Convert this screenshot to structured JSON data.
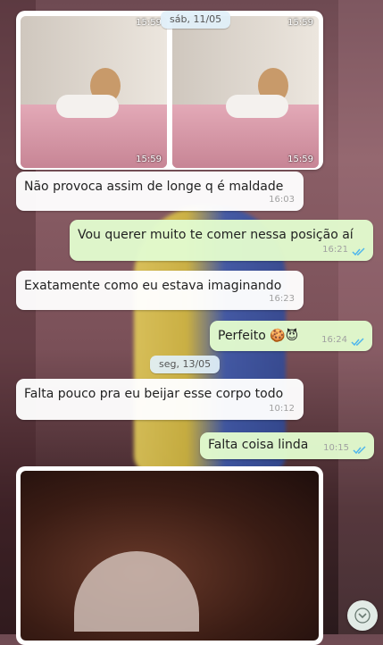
{
  "photos": {
    "left_time": "15:59",
    "right_time": "15:59",
    "header_left_time": "15:59",
    "header_right_time": "15:59"
  },
  "date_separators": {
    "first": "sáb, 11/05",
    "second": "seg, 13/05"
  },
  "messages": [
    {
      "direction": "in",
      "text": "Não provoca assim de longe q é maldade",
      "time": "16:03"
    },
    {
      "direction": "out",
      "text": "Vou querer muito te comer nessa posição aí",
      "time": "16:21"
    },
    {
      "direction": "in",
      "text": "Exatamente como eu estava imaginando",
      "time": "16:23"
    },
    {
      "direction": "out",
      "text": "Perfeito 🍪😈",
      "time": "16:24"
    },
    {
      "direction": "in",
      "text": "Falta pouco pra eu beijar esse corpo todo",
      "time": "10:12"
    },
    {
      "direction": "out",
      "text": "Falta coisa linda",
      "time": "10:15"
    }
  ],
  "colors": {
    "incoming_bubble": "#ffffff",
    "outgoing_bubble": "#e1facd",
    "read_tick": "#4fb6ec"
  },
  "icons": {
    "read_receipt": "double-check-icon",
    "scroll": "chevron-down-icon"
  }
}
